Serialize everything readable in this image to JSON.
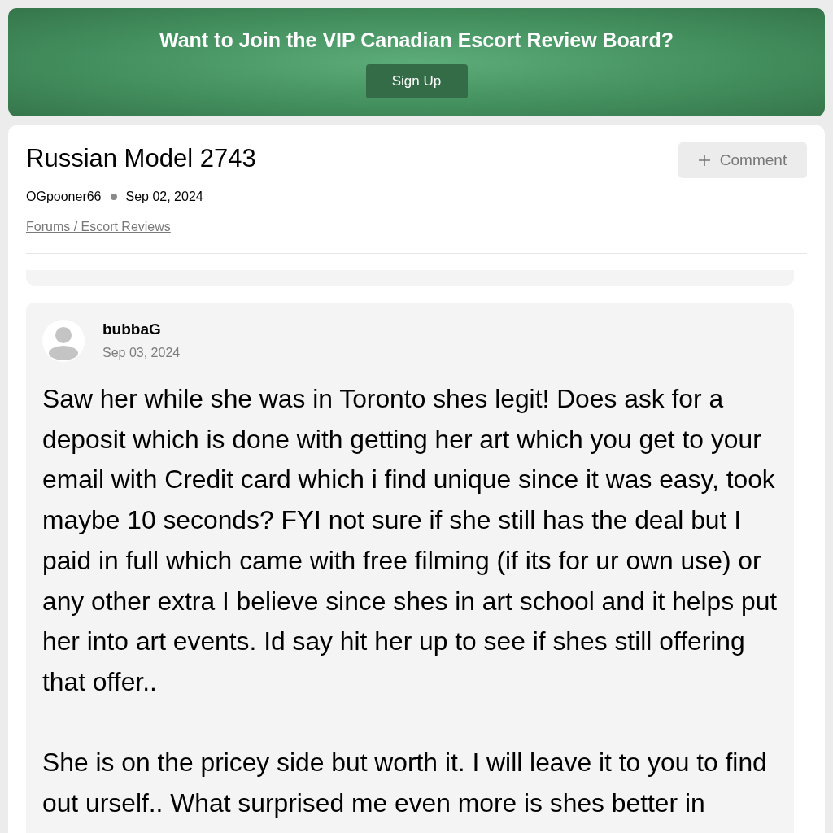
{
  "banner": {
    "title": "Want to Join the VIP Canadian Escort Review Board?",
    "button": "Sign Up"
  },
  "thread": {
    "title": "Russian Model 2743",
    "comment_button": "Comment",
    "author": "OGpooner66",
    "date": "Sep 02, 2024",
    "breadcrumb": "Forums / Escort Reviews"
  },
  "comments": [
    {
      "author": "bubbaG",
      "date": "Sep 03, 2024",
      "paragraphs": [
        "Saw her while she was in Toronto shes legit! Does ask for a deposit which is done with getting her art which you get to your email with Credit card which i find unique since it was easy, took maybe 10 seconds? FYI not sure if she still has the deal but I paid in full which came with free filming (if its for ur own use) or any other extra I believe since shes in art school and it helps put her into art events. Id say hit her up to see if shes still offering that offer..",
        "She is on the pricey side but worth it. I will leave it to you to find out urself.. What surprised me even more is shes better in"
      ]
    }
  ]
}
